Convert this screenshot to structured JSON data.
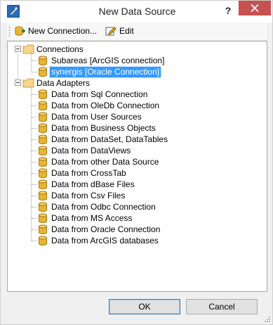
{
  "window": {
    "title": "New Data Source",
    "help_glyph": "?"
  },
  "toolbar": {
    "new_connection_label": "New Connection...",
    "edit_label": "Edit"
  },
  "tree": {
    "connections": {
      "label": "Connections",
      "items": [
        {
          "label": "Subareas [ArcGIS connection]",
          "selected": false
        },
        {
          "label": "synergis [Oracle Connection]",
          "selected": true
        }
      ]
    },
    "data_adapters": {
      "label": "Data Adapters",
      "items": [
        "Data from Sql Connection",
        "Data from OleDb Connection",
        "Data from User Sources",
        "Data from Business Objects",
        "Data from DataSet, DataTables",
        "Data from DataViews",
        "Data from other Data Source",
        "Data from CrossTab",
        "Data from dBase Files",
        "Data from Csv Files",
        "Data from Odbc Connection",
        "Data from MS Access",
        "Data from Oracle Connection",
        "Data from ArcGIS databases"
      ]
    }
  },
  "buttons": {
    "ok": "OK",
    "cancel": "Cancel"
  },
  "colors": {
    "selection": "#3399ff",
    "close_button": "#c75050",
    "database_icon": "#e8b432",
    "folder_icon": "#f5d68a"
  }
}
